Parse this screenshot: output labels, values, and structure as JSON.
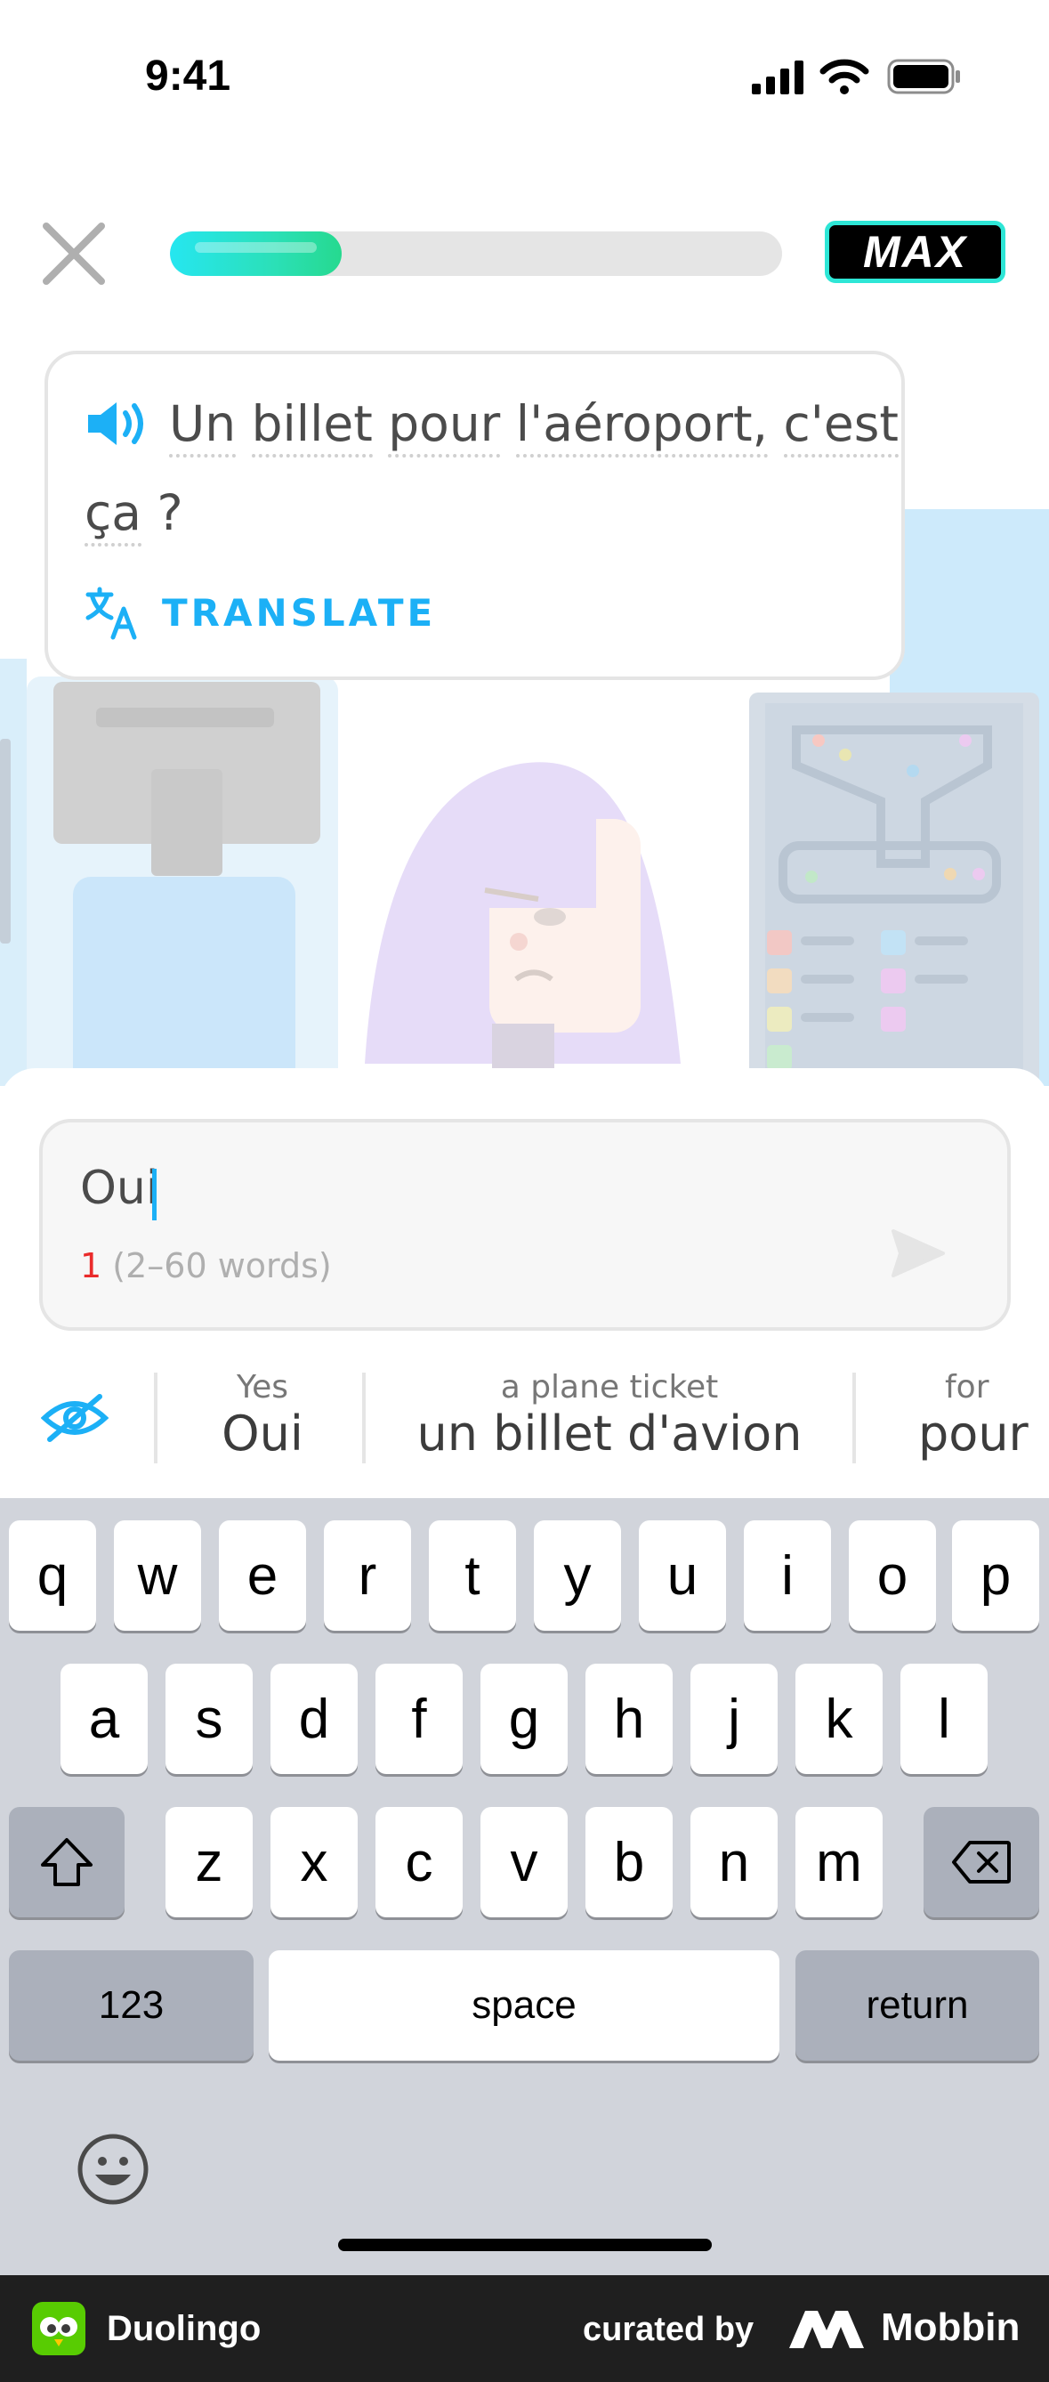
{
  "status_bar": {
    "time": "9:41"
  },
  "header": {
    "progress_percent": 28,
    "badge": "MAX"
  },
  "prompt": {
    "line1_words": [
      "Un",
      "billet",
      "pour",
      "l'aéroport,",
      "c'est"
    ],
    "line2_words": [
      "ça",
      "?"
    ],
    "translate_label": "TRANSLATE"
  },
  "answer": {
    "value": "Oui",
    "word_count": "1",
    "word_range": "(2–60 words)"
  },
  "suggestions": [
    {
      "hint": "Yes",
      "word": "Oui"
    },
    {
      "hint": "a plane ticket",
      "word": "un billet d'avion"
    },
    {
      "hint": "for",
      "word": "pour"
    }
  ],
  "keyboard": {
    "row1": [
      "q",
      "w",
      "e",
      "r",
      "t",
      "y",
      "u",
      "i",
      "o",
      "p"
    ],
    "row2": [
      "a",
      "s",
      "d",
      "f",
      "g",
      "h",
      "j",
      "k",
      "l"
    ],
    "row3": [
      "z",
      "x",
      "c",
      "v",
      "b",
      "n",
      "m"
    ],
    "numbers_label": "123",
    "space_label": "space",
    "return_label": "return"
  },
  "footer": {
    "app_name": "Duolingo",
    "curated_by": "curated by",
    "brand": "Mobbin"
  },
  "colors": {
    "accent_blue": "#1cb0f6",
    "progress_green": "#2be0b8",
    "error_red": "#ea2b2b"
  }
}
